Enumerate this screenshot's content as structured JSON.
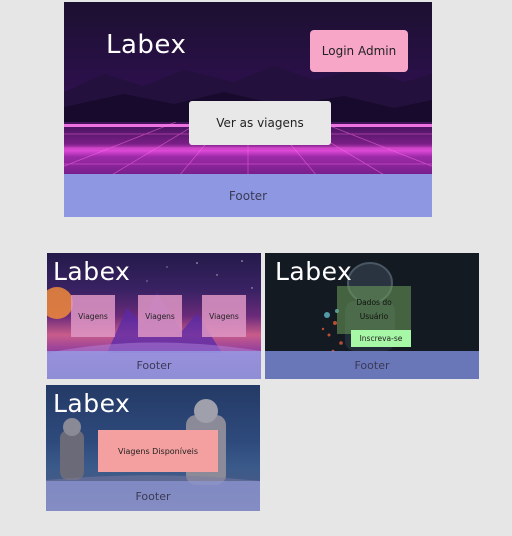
{
  "frames": {
    "home": {
      "brand": "Labex",
      "login_label": "Login Admin",
      "trips_label": "Ver as viagens",
      "footer": "Footer"
    },
    "trips": {
      "brand": "Labex",
      "cards": [
        "Viagens",
        "Viagens",
        "Viagens"
      ],
      "footer": "Footer"
    },
    "signup": {
      "brand": "Labex",
      "user_data_line1": "Dados do",
      "user_data_line2": "Usuário",
      "signup_label": "Inscreva-se",
      "footer": "Footer"
    },
    "available": {
      "brand": "Labex",
      "available_label": "Viagens Disponíveis",
      "footer": "Footer"
    }
  },
  "colors": {
    "background": "#e6e6e6",
    "login_button": "#f7a6c8",
    "trips_button": "#e8e8e8",
    "footer": "#8e98e2",
    "signup_button": "#a6f7a6",
    "available_box": "#f4a0a0"
  }
}
